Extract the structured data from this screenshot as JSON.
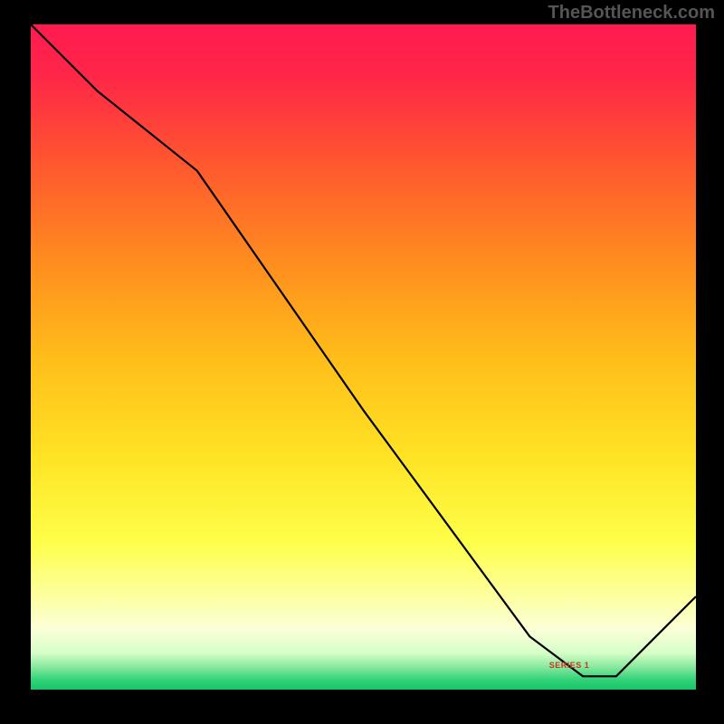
{
  "watermark": "TheBottleneck.com",
  "colors": {
    "background": "#000000",
    "line": "#000000",
    "label": "#cc3322",
    "gradient_stops": [
      {
        "offset": 0.0,
        "color": "#ff1a4f"
      },
      {
        "offset": 0.08,
        "color": "#ff2748"
      },
      {
        "offset": 0.2,
        "color": "#ff5430"
      },
      {
        "offset": 0.35,
        "color": "#ff8a1f"
      },
      {
        "offset": 0.5,
        "color": "#ffbd1a"
      },
      {
        "offset": 0.65,
        "color": "#ffe324"
      },
      {
        "offset": 0.78,
        "color": "#feff4a"
      },
      {
        "offset": 0.86,
        "color": "#fdffa0"
      },
      {
        "offset": 0.91,
        "color": "#fbffd8"
      },
      {
        "offset": 0.945,
        "color": "#d6ffc7"
      },
      {
        "offset": 0.965,
        "color": "#8be9a0"
      },
      {
        "offset": 0.985,
        "color": "#33d37a"
      },
      {
        "offset": 1.0,
        "color": "#15c668"
      }
    ]
  },
  "chart_data": {
    "type": "line",
    "title": "",
    "xlabel": "",
    "ylabel": "",
    "xlim": [
      0,
      100
    ],
    "ylim": [
      0,
      100
    ],
    "series": [
      {
        "name": "SERIES 1",
        "x": [
          0,
          10,
          25,
          50,
          75,
          83,
          88,
          100
        ],
        "y": [
          100,
          90,
          78,
          42,
          8,
          2,
          2,
          14
        ]
      }
    ],
    "label_anchor": {
      "x": 82,
      "y": 3
    }
  }
}
